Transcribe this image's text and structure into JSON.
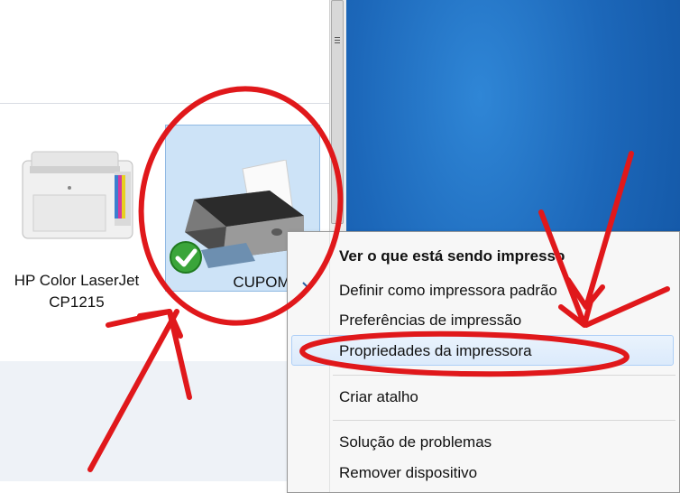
{
  "devices": [
    {
      "label_line1": "HP Color LaserJet",
      "label_line2": "CP1215",
      "icon": "laser-printer-icon"
    },
    {
      "label": "CUPOM",
      "icon": "default-printer-icon",
      "badge": "check-icon",
      "selected": true
    }
  ],
  "context_menu": {
    "items": [
      {
        "label": "Ver o que está sendo impresso",
        "bold": true
      },
      {
        "label": "Definir como impressora padrão"
      },
      {
        "label": "Preferências de impressão"
      },
      {
        "label": "Propriedades da impressora",
        "highlighted": true
      },
      {
        "label": "Criar atalho"
      },
      {
        "label": "Solução de problemas"
      },
      {
        "label": "Remover dispositivo"
      }
    ]
  },
  "annotations": {
    "color": "#e0181b",
    "shapes": [
      "circle-around-cupom",
      "ellipse-around-properties",
      "arrows"
    ]
  },
  "colors": {
    "desktop": "#1c67b9",
    "selection": "#cde3f7",
    "menu_bg": "#f7f7f7"
  }
}
